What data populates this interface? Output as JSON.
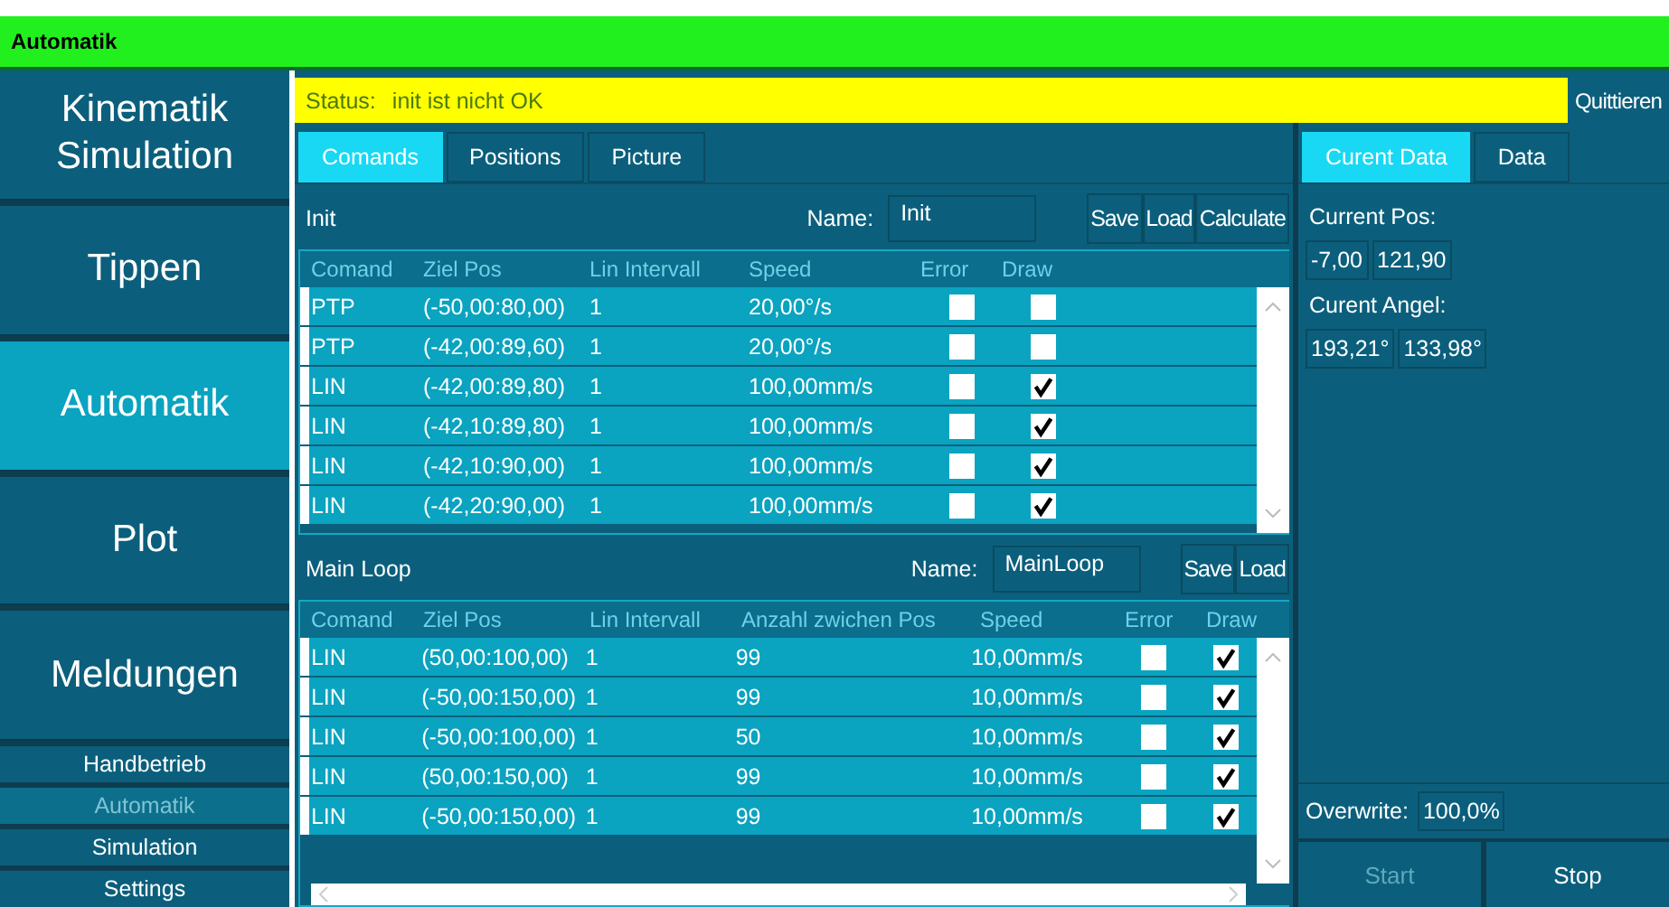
{
  "window": {
    "title": "Automatik"
  },
  "sidebar": {
    "items": [
      {
        "label": "Kinematik Simulation",
        "selected": false
      },
      {
        "label": "Tippen",
        "selected": false
      },
      {
        "label": "Automatik",
        "selected": true
      },
      {
        "label": "Plot",
        "selected": false
      },
      {
        "label": "Meldungen",
        "selected": false
      }
    ],
    "sub_items": [
      {
        "label": "Handbetrieb",
        "disabled": false
      },
      {
        "label": "Automatik",
        "disabled": true
      },
      {
        "label": "Simulation",
        "disabled": false
      },
      {
        "label": "Settings",
        "disabled": false
      }
    ]
  },
  "status": {
    "label": "Status:",
    "text": "init ist nicht OK",
    "button": "Quittieren"
  },
  "tabs": [
    {
      "label": "Comands",
      "selected": true
    },
    {
      "label": "Positions",
      "selected": false
    },
    {
      "label": "Picture",
      "selected": false
    }
  ],
  "sections": [
    {
      "title": "Init",
      "name_label": "Name:",
      "name_value": "Init",
      "buttons": [
        "Save",
        "Load",
        "Calculate"
      ],
      "columns": [
        "Comand",
        "Ziel Pos",
        "Lin Intervall",
        "Speed",
        "Error",
        "Draw"
      ],
      "rows": [
        {
          "cells": [
            "PTP",
            "(-50,00:80,00)",
            "1",
            "20,00°/s"
          ],
          "error": false,
          "draw": false
        },
        {
          "cells": [
            "PTP",
            "(-42,00:89,60)",
            "1",
            "20,00°/s"
          ],
          "error": false,
          "draw": false
        },
        {
          "cells": [
            "LIN",
            "(-42,00:89,80)",
            "1",
            "100,00mm/s"
          ],
          "error": false,
          "draw": true
        },
        {
          "cells": [
            "LIN",
            "(-42,10:89,80)",
            "1",
            "100,00mm/s"
          ],
          "error": false,
          "draw": true
        },
        {
          "cells": [
            "LIN",
            "(-42,10:90,00)",
            "1",
            "100,00mm/s"
          ],
          "error": false,
          "draw": true
        },
        {
          "cells": [
            "LIN",
            "(-42,20:90,00)",
            "1",
            "100,00mm/s"
          ],
          "error": false,
          "draw": true
        }
      ]
    },
    {
      "title": "Main Loop",
      "name_label": "Name:",
      "name_value": "MainLoop",
      "buttons": [
        "Save",
        "Load"
      ],
      "columns": [
        "Comand",
        "Ziel Pos",
        "Lin Intervall",
        "Anzahl zwichen Pos",
        "Speed",
        "Error",
        "Draw"
      ],
      "rows": [
        {
          "cells": [
            "LIN",
            "(50,00:100,00)",
            "1",
            "99",
            "10,00mm/s"
          ],
          "error": false,
          "draw": true
        },
        {
          "cells": [
            "LIN",
            "(-50,00:150,00)",
            "1",
            "99",
            "10,00mm/s"
          ],
          "error": false,
          "draw": true
        },
        {
          "cells": [
            "LIN",
            "(-50,00:100,00)",
            "1",
            "50",
            "10,00mm/s"
          ],
          "error": false,
          "draw": true
        },
        {
          "cells": [
            "LIN",
            "(50,00:150,00)",
            "1",
            "99",
            "10,00mm/s"
          ],
          "error": false,
          "draw": true
        },
        {
          "cells": [
            "LIN",
            "(-50,00:150,00)",
            "1",
            "99",
            "10,00mm/s"
          ],
          "error": false,
          "draw": true
        }
      ]
    }
  ],
  "right_tabs": [
    {
      "label": "Curent Data",
      "selected": true
    },
    {
      "label": "Data",
      "selected": false
    }
  ],
  "current": [
    {
      "label": "Current Pos:",
      "values": [
        "-7,00",
        "121,90"
      ]
    },
    {
      "label": "Curent Angel:",
      "values": [
        "193,21°",
        "133,98°"
      ]
    }
  ],
  "overwrite": {
    "label": "Overwrite:",
    "value": "100,0%"
  },
  "actions": [
    {
      "label": "Start",
      "disabled": true
    },
    {
      "label": "Stop",
      "disabled": false
    }
  ]
}
